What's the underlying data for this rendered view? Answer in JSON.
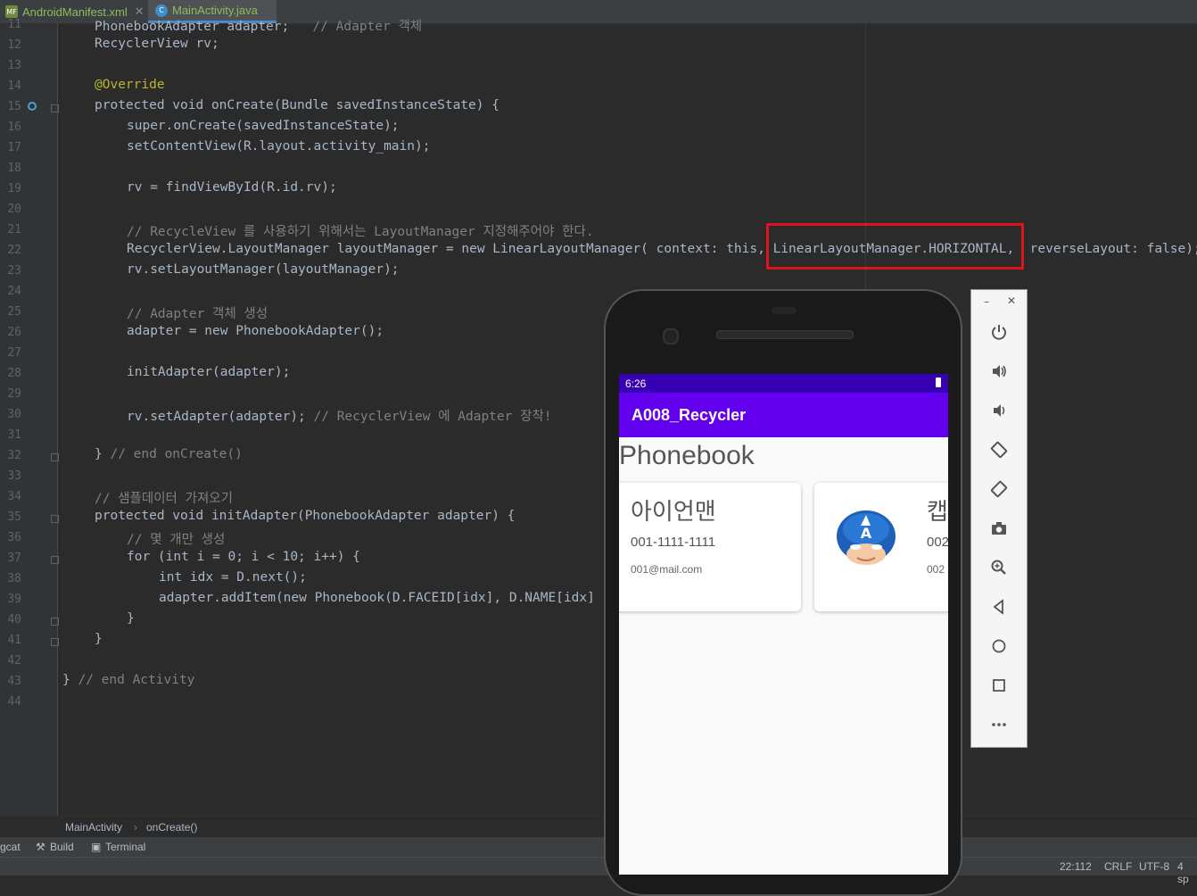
{
  "tabs": [
    {
      "label": "AndroidManifest.xml",
      "icon": "xml-file-icon",
      "badge": "MF"
    },
    {
      "label": "MainActivity.java",
      "icon": "java-class-icon",
      "badge": "C"
    }
  ],
  "editor": {
    "lines": [
      {
        "n": "11",
        "text": "PhonebookAdapter adapter;   // Adapter 객체"
      },
      {
        "n": "12",
        "text": "RecyclerView rv;"
      },
      {
        "n": "13",
        "text": ""
      },
      {
        "n": "14",
        "text": "@Override"
      },
      {
        "n": "15",
        "text": "protected void onCreate(Bundle savedInstanceState) {"
      },
      {
        "n": "16",
        "text": "super.onCreate(savedInstanceState);"
      },
      {
        "n": "17",
        "text": "setContentView(R.layout.activity_main);"
      },
      {
        "n": "18",
        "text": ""
      },
      {
        "n": "19",
        "text": "rv = findViewById(R.id.rv);"
      },
      {
        "n": "20",
        "text": ""
      },
      {
        "n": "21",
        "text": "// RecycleView 를 사용하기 위해서는 LayoutManager 지정해주어야 한다."
      },
      {
        "n": "22",
        "text": "RecyclerView.LayoutManager layoutManager = new LinearLayoutManager( context: this, LinearLayoutManager.HORIZONTAL,  reverseLayout: false);"
      },
      {
        "n": "23",
        "text": "rv.setLayoutManager(layoutManager);"
      },
      {
        "n": "24",
        "text": ""
      },
      {
        "n": "25",
        "text": "// Adapter 객체 생성"
      },
      {
        "n": "26",
        "text": "adapter = new PhonebookAdapter();"
      },
      {
        "n": "27",
        "text": ""
      },
      {
        "n": "28",
        "text": "initAdapter(adapter);"
      },
      {
        "n": "29",
        "text": ""
      },
      {
        "n": "30",
        "text": "rv.setAdapter(adapter); // RecyclerView 에 Adapter 장착!"
      },
      {
        "n": "31",
        "text": ""
      },
      {
        "n": "32",
        "text": "} // end onCreate()"
      },
      {
        "n": "33",
        "text": ""
      },
      {
        "n": "34",
        "text": "// 샘플데이터 가져오기"
      },
      {
        "n": "35",
        "text": "protected void initAdapter(PhonebookAdapter adapter) {"
      },
      {
        "n": "36",
        "text": "// 몇 개만 생성"
      },
      {
        "n": "37",
        "text": "for (int i = 0; i < 10; i++) {"
      },
      {
        "n": "38",
        "text": "int idx = D.next();"
      },
      {
        "n": "39",
        "text": "adapter.addItem(new Phonebook(D.FACEID[idx], D.NAME[idx]"
      },
      {
        "n": "40",
        "text": "}"
      },
      {
        "n": "41",
        "text": "}"
      },
      {
        "n": "42",
        "text": ""
      },
      {
        "n": "43",
        "text": "} // end Activity"
      },
      {
        "n": "44",
        "text": ""
      }
    ]
  },
  "breadcrumb": {
    "class": "MainActivity",
    "method": "onCreate()"
  },
  "tool_windows": [
    {
      "label": "gcat",
      "icon": "logcat-icon"
    },
    {
      "label": "Build",
      "icon": "hammer-icon"
    },
    {
      "label": "Terminal",
      "icon": "terminal-icon"
    }
  ],
  "status": {
    "position": "22:112",
    "line_sep": "CRLF",
    "encoding": "UTF-8",
    "indent": "4 sp"
  },
  "emulator": {
    "time": "6:26",
    "app_title": "A008_Recycler",
    "heading": "Phonebook",
    "cards": [
      {
        "name": "아이언맨",
        "phone": "001-1111-1111",
        "email": "001@mail.com"
      },
      {
        "name": "캡",
        "phone": "002",
        "email": "002"
      }
    ],
    "controls": [
      "minimize-icon",
      "close-icon",
      "power-icon",
      "volume-up-icon",
      "volume-down-icon",
      "rotate-left-icon",
      "rotate-right-icon",
      "camera-icon",
      "zoom-icon",
      "back-icon",
      "home-icon",
      "overview-icon",
      "more-icon"
    ]
  },
  "colors": {
    "highlight_box": "#e0141e",
    "app_bar": "#6200ee",
    "status_bar": "#3700b3"
  }
}
